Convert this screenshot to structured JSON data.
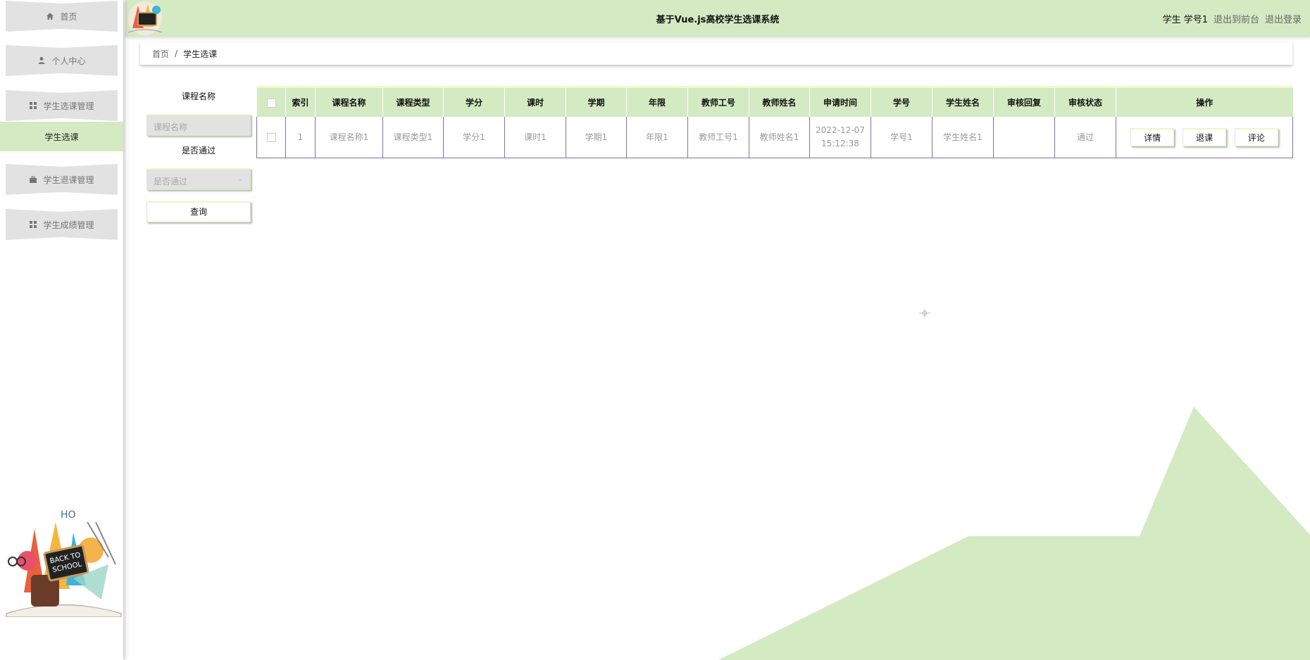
{
  "header": {
    "title": "基于Vue.js高校学生选课系统",
    "user_info": "学生 学号1",
    "back_to_front": "退出到前台",
    "logout": "退出登录"
  },
  "sidebar": {
    "items": [
      {
        "label": "首页",
        "icon": "home-icon"
      },
      {
        "label": "个人中心",
        "icon": "user-icon"
      },
      {
        "label": "学生选课管理",
        "icon": "grid-icon"
      },
      {
        "label": "学生选课",
        "active": true
      },
      {
        "label": "学生退课管理",
        "icon": "briefcase-icon"
      },
      {
        "label": "学生成绩管理",
        "icon": "grid-icon"
      }
    ]
  },
  "breadcrumb": {
    "home": "首页",
    "separator": "/",
    "current": "学生选课"
  },
  "search": {
    "course_name_label": "课程名称",
    "course_name_placeholder": "课程名称",
    "passed_label": "是否通过",
    "passed_placeholder": "是否通过",
    "query_button": "查询"
  },
  "table": {
    "columns": [
      "索引",
      "课程名称",
      "课程类型",
      "学分",
      "课时",
      "学期",
      "年限",
      "教师工号",
      "教师姓名",
      "申请时间",
      "学号",
      "学生姓名",
      "审核回复",
      "审核状态",
      "操作"
    ],
    "rows": [
      {
        "index": "1",
        "course_name": "课程名称1",
        "course_type": "课程类型1",
        "credit": "学分1",
        "hours": "课时1",
        "term": "学期1",
        "years": "年限1",
        "teacher_id": "教师工号1",
        "teacher_name": "教师姓名1",
        "apply_date": "2022-12-07",
        "apply_time": "15:12:38",
        "student_id": "学号1",
        "student_name": "学生姓名1",
        "review_reply": "",
        "review_status": "通过"
      }
    ],
    "actions": {
      "detail": "详情",
      "drop": "退课",
      "comment": "评论"
    }
  },
  "colors": {
    "accent": "#d4eac3",
    "menu_bg": "#e2e2e2",
    "border": "#7c73a8",
    "button_top": "#f1f5c7"
  }
}
